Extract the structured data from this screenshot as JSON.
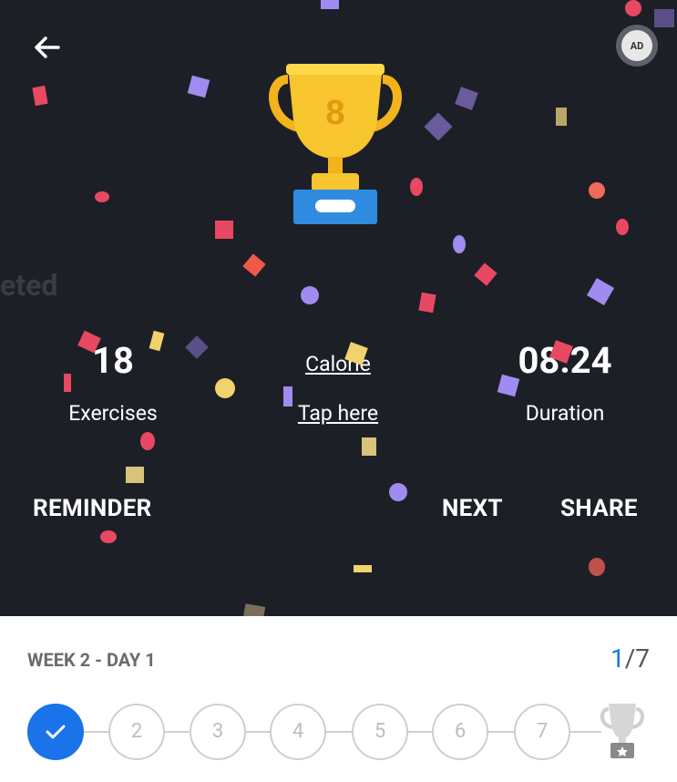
{
  "header": {
    "back_icon": "arrow-left-icon",
    "ad_label": "AD"
  },
  "trophy": {
    "number": "8"
  },
  "ghost_text": "eted",
  "stats": {
    "exercises": {
      "value": "18",
      "label": "Exercises"
    },
    "calorie": {
      "label": "Calorie",
      "action": "Tap here"
    },
    "duration": {
      "value": "08:24",
      "label": "Duration"
    }
  },
  "actions": {
    "reminder": "REMINDER",
    "next": "NEXT",
    "share": "SHARE"
  },
  "plan": {
    "week_day": "WEEK 2 - DAY 1",
    "progress_current": "1",
    "progress_total": "/7",
    "days": [
      "2",
      "3",
      "4",
      "5",
      "6",
      "7"
    ]
  },
  "colors": {
    "background": "#1d1f27",
    "accent": "#1a73e8"
  }
}
